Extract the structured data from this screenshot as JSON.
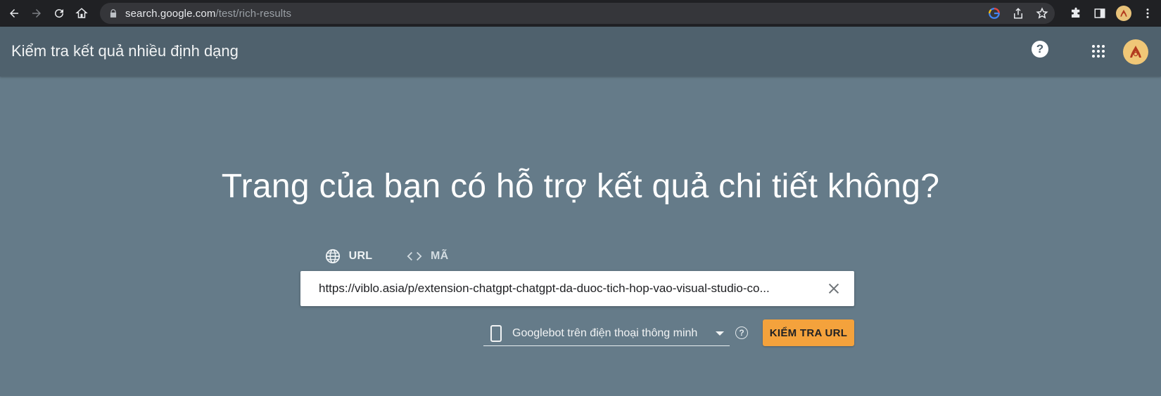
{
  "browser": {
    "url_domain": "search.google.com",
    "url_path": "/test/rich-results"
  },
  "header": {
    "title": "Kiểm tra kết quả nhiều định dạng",
    "help_symbol": "?"
  },
  "hero": {
    "headline": "Trang của bạn có hỗ trợ kết quả chi tiết không?"
  },
  "tabs": [
    {
      "label": "URL",
      "icon": "globe-icon",
      "active": true
    },
    {
      "label": "MÃ",
      "icon": "code-icon",
      "active": false
    }
  ],
  "input": {
    "value": "https://viblo.asia/p/extension-chatgpt-chatgpt-da-duoc-tich-hop-vao-visual-studio-co..."
  },
  "agent": {
    "label": "Googlebot trên điện thoại thông minh",
    "help_symbol": "?"
  },
  "actions": {
    "test_label": "KIỂM TRA URL"
  },
  "colors": {
    "accent": "#f4a23c",
    "page_bg": "#657b89",
    "header_bg": "#4f616d"
  }
}
